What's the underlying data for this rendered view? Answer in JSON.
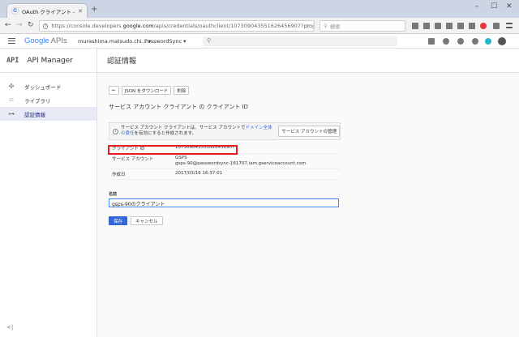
{
  "browser": {
    "tab_title": "OAuth クライアント - Passwo…",
    "url_prefix": "https://console.developers.",
    "url_domain": "google.com",
    "url_suffix": "/apis/credentials/oauthclient/107309043551626456907?project=passwor",
    "search_placeholder": "検索"
  },
  "header": {
    "logo_google": "Google",
    "logo_apis": "APIs",
    "account": "murashima.matsudo.chi... ▾",
    "project": "PasswordSync ▾"
  },
  "sidebar": {
    "api_badge": "API",
    "title": "API Manager",
    "items": [
      {
        "label": "ダッシュボード",
        "icon": "✣"
      },
      {
        "label": "ライブラリ",
        "icon": "⁝⁝⁝"
      },
      {
        "label": "認証情報",
        "icon": "⊶"
      }
    ],
    "collapse": "<|"
  },
  "main": {
    "page_title": "認証情報",
    "toolbar": {
      "back": "←",
      "download": "JSON をダウンロード",
      "delete": "削除"
    },
    "subtitle": "サービス アカウント クライアント の クライアント ID",
    "notice": {
      "text_before": "サービス アカウント クライアントは、サービス アカウントで",
      "link": "ドメイン全体の委任",
      "text_after": "を有効にすると作成されます。",
      "button": "サービス アカウントの管理"
    },
    "details": [
      {
        "key": "クライアント ID",
        "value": "107309043551626456907"
      },
      {
        "key": "サービス アカウント",
        "value": "GSPS",
        "value2": "gsps-90@passwordsync-161707.iam.gserviceaccount.com"
      },
      {
        "key": "作成日",
        "value": "2017/03/16 16:37:01"
      }
    ],
    "name_label": "名前",
    "name_value": "gsps-90のクライアント",
    "save": "保存",
    "cancel": "キャンセル"
  },
  "colors": {
    "accent": "#3367d6",
    "highlight": "#e02020"
  }
}
